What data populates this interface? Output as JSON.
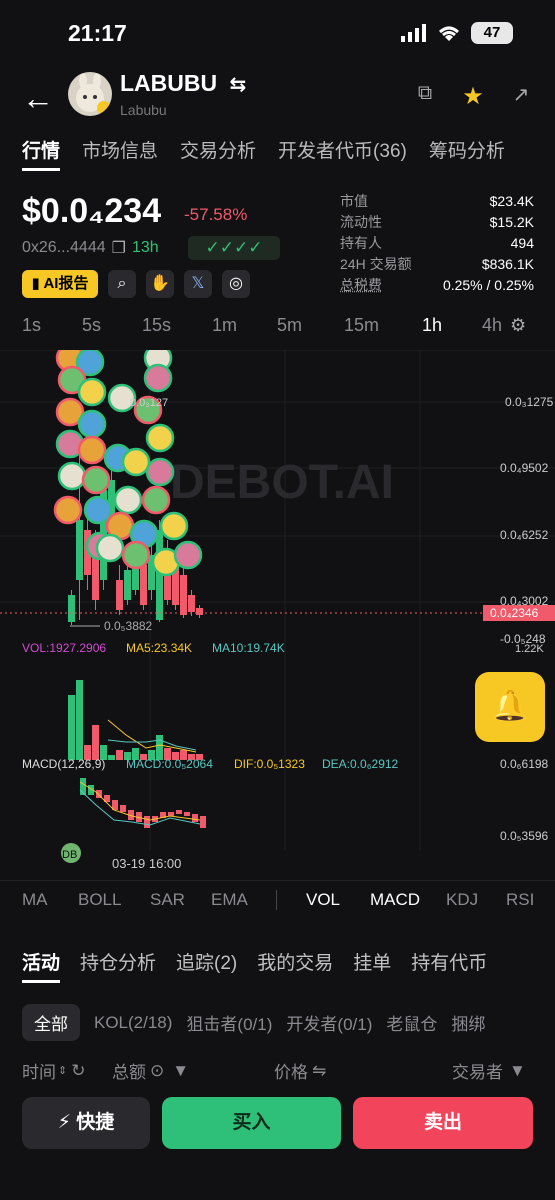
{
  "status": {
    "time": "21:17",
    "battery": "47"
  },
  "token": {
    "symbol": "LABUBU",
    "name": "Labubu",
    "price": "$0.0₄234",
    "change": "-57.58%",
    "address": "0x26...4444",
    "age": "13h",
    "checks": "✓✓✓✓"
  },
  "tabs": [
    "行情",
    "市场信息",
    "交易分析",
    "开发者代币(36)",
    "筹码分析"
  ],
  "chips": {
    "ai_report": "AI报告"
  },
  "stats": [
    {
      "k": "市值",
      "v": "$23.4K"
    },
    {
      "k": "流动性",
      "v": "$15.2K"
    },
    {
      "k": "持有人",
      "v": "494"
    },
    {
      "k": "24H 交易额",
      "v": "$836.1K"
    },
    {
      "k": "总税费",
      "v": "0.25% / 0.25%"
    }
  ],
  "timeframes": [
    "1s",
    "5s",
    "15s",
    "1m",
    "5m",
    "15m",
    "1h",
    "4h"
  ],
  "chart": {
    "watermark": "DEBOT.AI",
    "price_labels": [
      "0.0₃1275",
      "0.0₄9502",
      "0.0₄6252",
      "0.0₄3002",
      "-0.0₅248"
    ],
    "current_price": "0.0₄2346",
    "low_label": "0.0₅3882",
    "high_label": "0.0₃127",
    "vol_label": "VOL:1927.2906",
    "ma5_label": "MA5:23.34K",
    "ma10_label": "MA10:19.74K",
    "vol_axis": "1.22K",
    "macd_label": "MACD(12,26,9)",
    "macd_val": "MACD:0.0₅2064",
    "dif_val": "DIF:0.0₅1323",
    "dea_val": "DEA:0.0₆2912",
    "macd_axis_1": "0.0₆6198",
    "macd_axis_2": "0.0₅3596",
    "time_label": "03-19 16:00",
    "badge": "DB"
  },
  "indicators": [
    "MA",
    "BOLL",
    "SAR",
    "EMA",
    "VOL",
    "MACD",
    "KDJ",
    "RSI"
  ],
  "activity_tabs": [
    "活动",
    "持仓分析",
    "追踪(2)",
    "我的交易",
    "挂单",
    "持有代币"
  ],
  "filters": [
    "全部",
    "KOL(2/18)",
    "狙击者(0/1)",
    "开发者(0/1)",
    "老鼠仓",
    "捆绑"
  ],
  "table_headers": {
    "time": "时间",
    "amount": "总额",
    "price": "价格",
    "trader": "交易者"
  },
  "buttons": {
    "quick": "快捷",
    "buy": "买入",
    "sell": "卖出"
  },
  "colors": {
    "up": "#2ec078",
    "down": "#f05a6a",
    "accent": "#f7c823"
  }
}
